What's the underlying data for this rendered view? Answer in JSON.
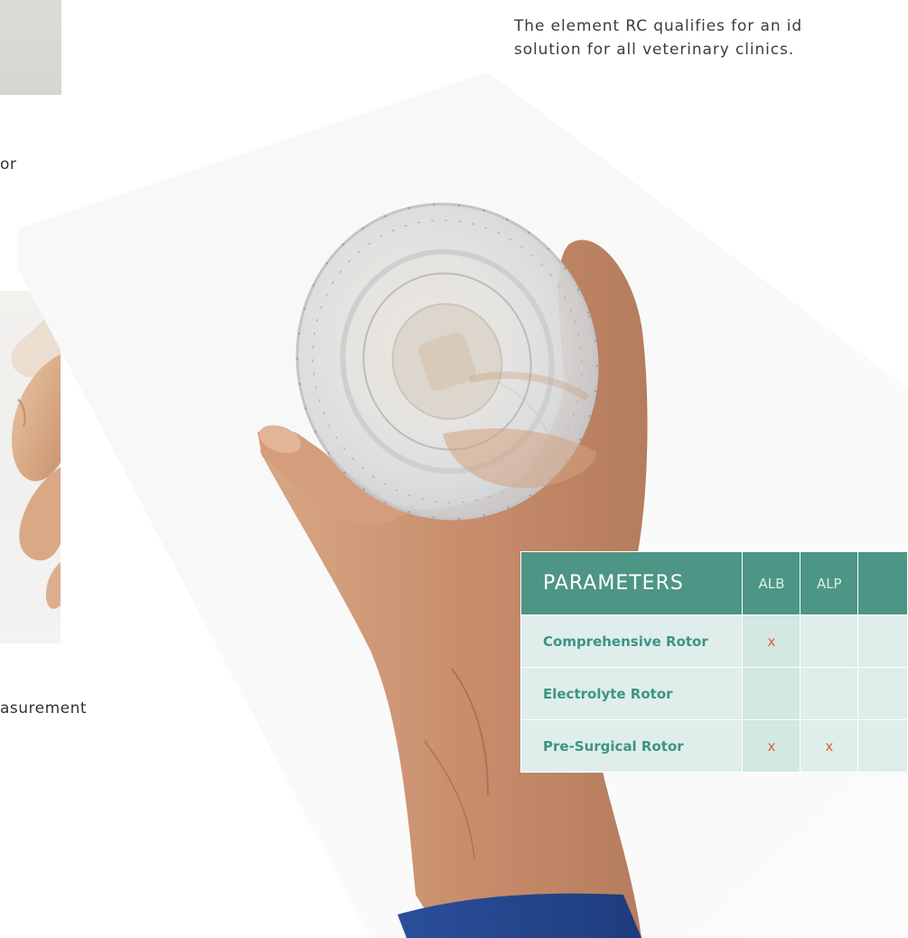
{
  "intro": {
    "line1": "The element RC qualifies for an id",
    "line2": "solution for all veterinary clinics."
  },
  "left_column": {
    "caption_1": "or",
    "caption_2": "asurement"
  },
  "table": {
    "header": "PARAMETERS",
    "columns": [
      "ALB",
      "ALP",
      ""
    ],
    "rows": [
      {
        "label": "Comprehensive Rotor",
        "cells": [
          "x",
          "",
          ""
        ]
      },
      {
        "label": "Electrolyte Rotor",
        "cells": [
          "",
          "",
          ""
        ]
      },
      {
        "label": "Pre-Surgical Rotor",
        "cells": [
          "x",
          "x",
          ""
        ]
      }
    ]
  },
  "colors": {
    "table_header": "#4d9585",
    "table_row": "#dfeeeb",
    "row_label": "#3e9484",
    "mark": "#d9612f"
  }
}
